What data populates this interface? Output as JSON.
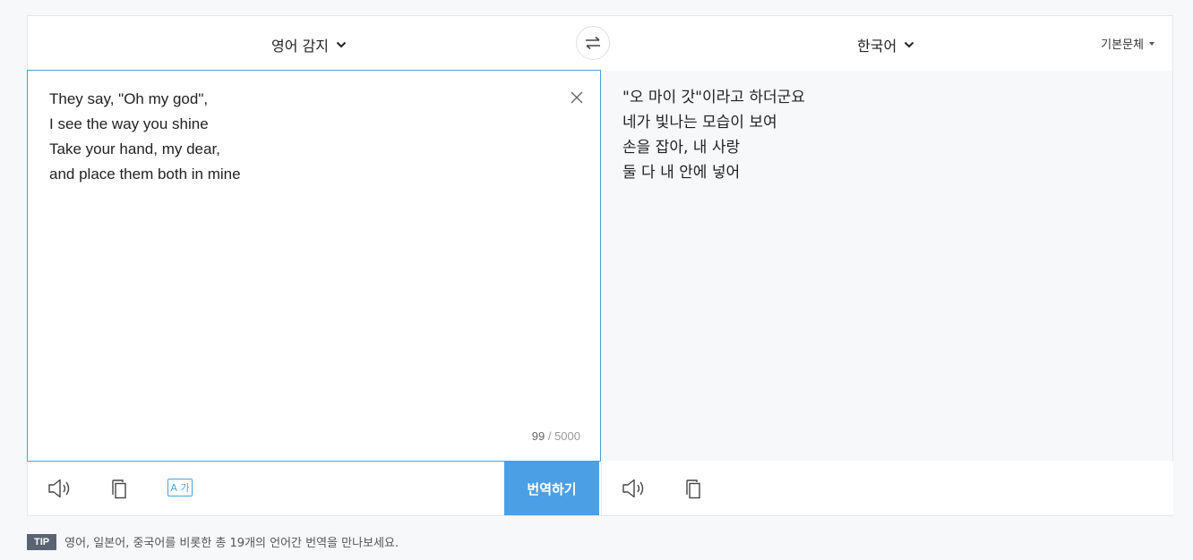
{
  "lang_bar": {
    "source_language": "영어 감지",
    "target_language": "한국어",
    "style_option": "기본문체"
  },
  "source": {
    "text": "They say, \"Oh my god\",\nI see the way you shine\nTake your hand, my dear,\nand place them both in mine",
    "char_count": "99",
    "char_limit": "/ 5000"
  },
  "target": {
    "text": "\"오 마이 갓\"이라고 하더군요\n네가 빛나는 모습이 보여\n손을 잡아, 내 사랑\n둘 다 내 안에 넣어"
  },
  "toolbar": {
    "hanja_label": "A 가",
    "translate_label": "번역하기"
  },
  "tip": {
    "badge": "TIP",
    "text": "영어, 일본어, 중국어를 비롯한 총 19개의 언어간 번역을 만나보세요."
  },
  "icons": {
    "speaker": "speaker-icon",
    "copy": "copy-icon",
    "swap": "swap-icon",
    "clear": "close-icon"
  },
  "colors": {
    "accent": "#4a9fe5",
    "active_border": "#4a9fd8",
    "tip_badge": "#5a6374"
  }
}
